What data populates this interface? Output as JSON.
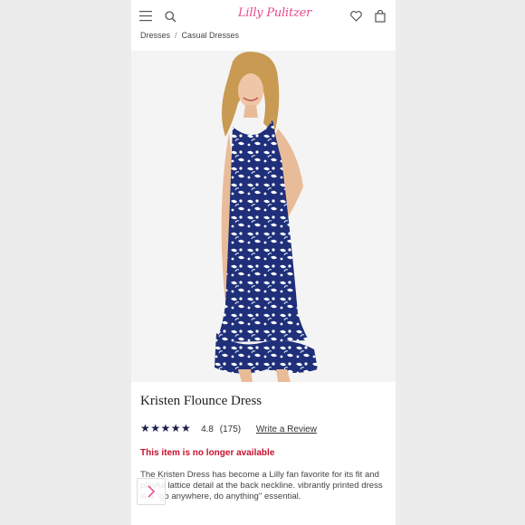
{
  "header": {
    "brand": "Lilly Pulitzer",
    "icons": [
      "menu-icon",
      "search-icon",
      "heart-icon",
      "bag-icon"
    ]
  },
  "breadcrumb": {
    "items": [
      "Dresses",
      "Casual Dresses"
    ],
    "separator": "/"
  },
  "product": {
    "name": "Kristen Flounce Dress",
    "rating": "4.8",
    "review_count": "(175)",
    "rating_stars": 4.8,
    "write_review": "Write a Review",
    "availability": "This item is no longer available",
    "description": "The Kristen Dress has become a Lilly fan favorite for its fit and playful lattice detail at the back neckline. vibrantly printed dress is a \"go anywhere, do anything\" essential."
  },
  "colors": {
    "brand_pink": "#e8488a",
    "alert_red": "#c8102e",
    "star_navy": "#1b1f4a",
    "print_navy": "#1f2f7a"
  }
}
